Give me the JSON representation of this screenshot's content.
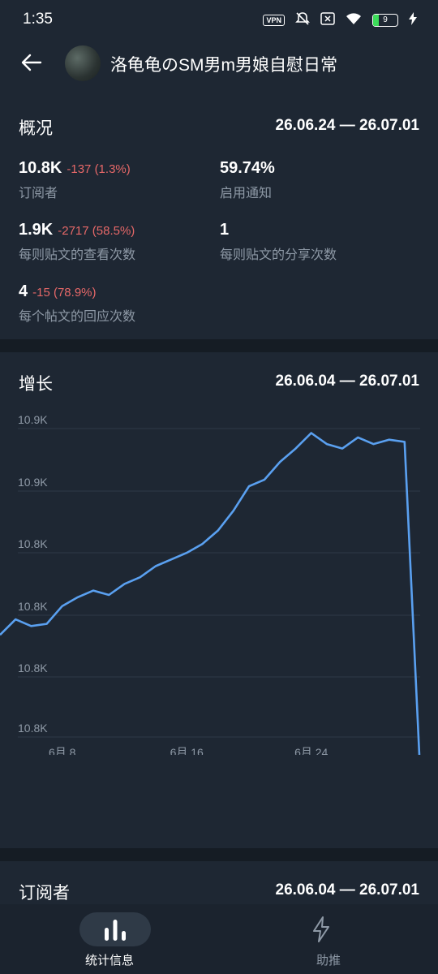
{
  "status_bar": {
    "time": "1:35",
    "vpn": "VPN",
    "battery": "9"
  },
  "header": {
    "title": "洛龟龟のSM男m男娘自慰日常"
  },
  "overview": {
    "title": "概况",
    "range": "26.06.24 — 26.07.01",
    "stats": [
      {
        "value": "10.8K",
        "delta": "-137 (1.3%)",
        "label": "订阅者"
      },
      {
        "value": "59.74%",
        "delta": "",
        "label": "启用通知"
      },
      {
        "value": "1.9K",
        "delta": "-2717 (58.5%)",
        "label": "每则贴文的查看次数"
      },
      {
        "value": "1",
        "delta": "",
        "label": "每则贴文的分享次数"
      },
      {
        "value": "4",
        "delta": "-15 (78.9%)",
        "label": "每个帖文的回应次数"
      }
    ]
  },
  "growth": {
    "title": "增长",
    "range": "26.06.04 — 26.07.01",
    "y_tick_labels": [
      "10.9K",
      "10.9K",
      "10.8K",
      "10.8K",
      "10.8K",
      "10.8K"
    ],
    "x_tick_labels": [
      "6月 8",
      "6月 16",
      "6月 24"
    ]
  },
  "chart_data": {
    "type": "line",
    "title": "增长",
    "x": [
      "06-04",
      "06-05",
      "06-06",
      "06-07",
      "06-08",
      "06-09",
      "06-10",
      "06-11",
      "06-12",
      "06-13",
      "06-14",
      "06-15",
      "06-16",
      "06-17",
      "06-18",
      "06-19",
      "06-20",
      "06-21",
      "06-22",
      "06-23",
      "06-24",
      "06-25",
      "06-26",
      "06-27",
      "06-28",
      "06-29",
      "06-30",
      "07-01"
    ],
    "series": [
      {
        "values": [
          10825,
          10832,
          10829,
          10830,
          10838,
          10842,
          10845,
          10843,
          10848,
          10851,
          10856,
          10859,
          10862,
          10866,
          10872,
          10881,
          10892,
          10895,
          10903,
          10909,
          10916,
          10911,
          10909,
          10914,
          10911,
          10913,
          10912,
          10763
        ],
        "color": "#5aa0f0"
      }
    ],
    "ylim": [
      10779,
      10918
    ],
    "grid": true
  },
  "subscribers": {
    "title": "订阅者",
    "range": "26.06.04 — 26.07.01"
  },
  "bottom_nav": {
    "stats_label": "统计信息",
    "boost_label": "助推"
  },
  "colors": {
    "background": "#1e2733",
    "line": "#5aa0f0",
    "negative": "#e66868",
    "muted": "#8e99a6"
  }
}
